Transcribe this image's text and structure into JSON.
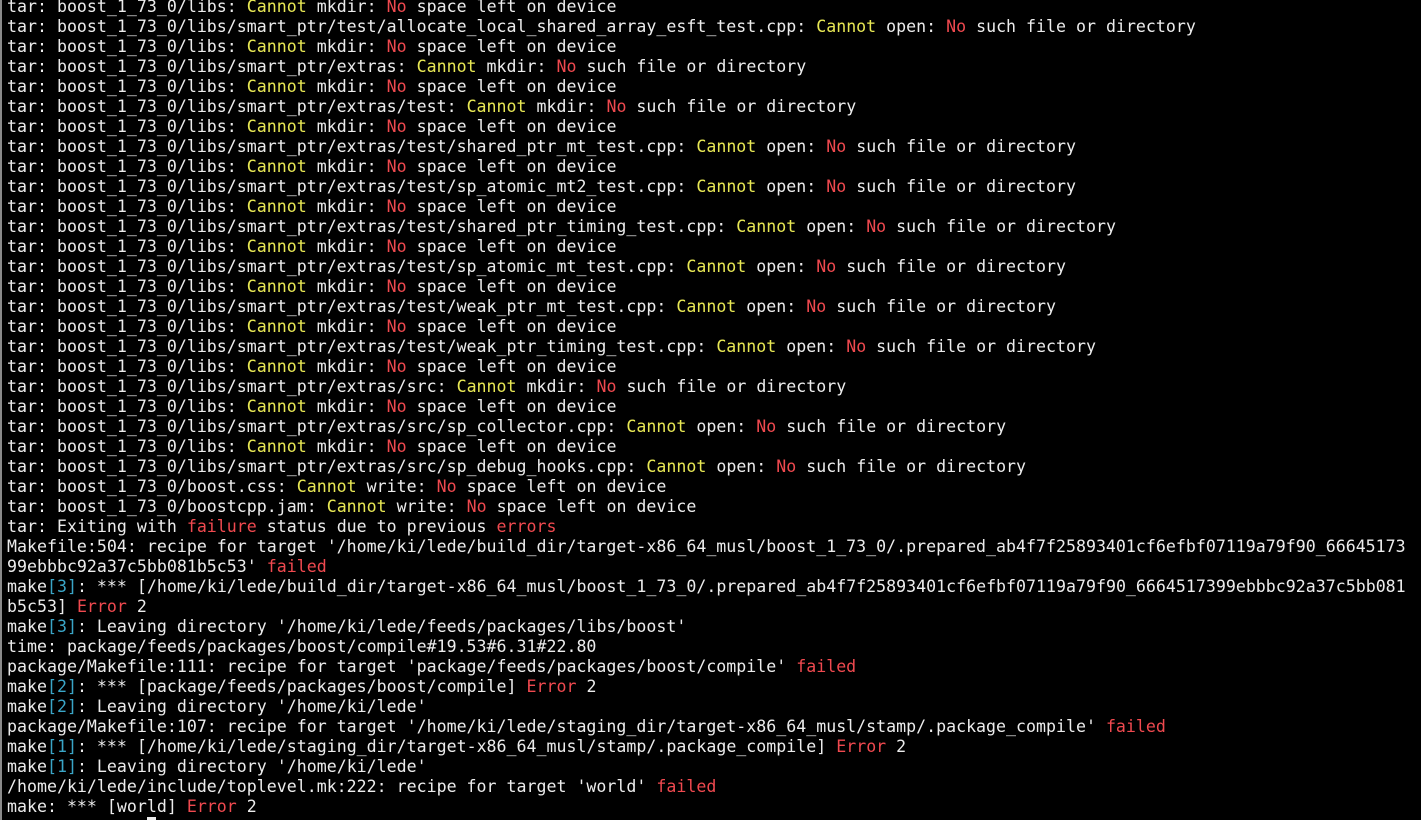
{
  "terminal": {
    "lines": [
      [
        [
          "d",
          "tar: boost_1_73_0/libs: "
        ],
        [
          "y",
          "Cannot"
        ],
        [
          "d",
          " mkdir: "
        ],
        [
          "r",
          "No"
        ],
        [
          "d",
          " space left on device"
        ]
      ],
      [
        [
          "d",
          "tar: boost_1_73_0/libs/smart_ptr/test/allocate_local_shared_array_esft_test.cpp: "
        ],
        [
          "y",
          "Cannot"
        ],
        [
          "d",
          " open: "
        ],
        [
          "r",
          "No"
        ],
        [
          "d",
          " such file or directory"
        ]
      ],
      [
        [
          "d",
          "tar: boost_1_73_0/libs: "
        ],
        [
          "y",
          "Cannot"
        ],
        [
          "d",
          " mkdir: "
        ],
        [
          "r",
          "No"
        ],
        [
          "d",
          " space left on device"
        ]
      ],
      [
        [
          "d",
          "tar: boost_1_73_0/libs/smart_ptr/extras: "
        ],
        [
          "y",
          "Cannot"
        ],
        [
          "d",
          " mkdir: "
        ],
        [
          "r",
          "No"
        ],
        [
          "d",
          " such file or directory"
        ]
      ],
      [
        [
          "d",
          "tar: boost_1_73_0/libs: "
        ],
        [
          "y",
          "Cannot"
        ],
        [
          "d",
          " mkdir: "
        ],
        [
          "r",
          "No"
        ],
        [
          "d",
          " space left on device"
        ]
      ],
      [
        [
          "d",
          "tar: boost_1_73_0/libs/smart_ptr/extras/test: "
        ],
        [
          "y",
          "Cannot"
        ],
        [
          "d",
          " mkdir: "
        ],
        [
          "r",
          "No"
        ],
        [
          "d",
          " such file or directory"
        ]
      ],
      [
        [
          "d",
          "tar: boost_1_73_0/libs: "
        ],
        [
          "y",
          "Cannot"
        ],
        [
          "d",
          " mkdir: "
        ],
        [
          "r",
          "No"
        ],
        [
          "d",
          " space left on device"
        ]
      ],
      [
        [
          "d",
          "tar: boost_1_73_0/libs/smart_ptr/extras/test/shared_ptr_mt_test.cpp: "
        ],
        [
          "y",
          "Cannot"
        ],
        [
          "d",
          " open: "
        ],
        [
          "r",
          "No"
        ],
        [
          "d",
          " such file or directory"
        ]
      ],
      [
        [
          "d",
          "tar: boost_1_73_0/libs: "
        ],
        [
          "y",
          "Cannot"
        ],
        [
          "d",
          " mkdir: "
        ],
        [
          "r",
          "No"
        ],
        [
          "d",
          " space left on device"
        ]
      ],
      [
        [
          "d",
          "tar: boost_1_73_0/libs/smart_ptr/extras/test/sp_atomic_mt2_test.cpp: "
        ],
        [
          "y",
          "Cannot"
        ],
        [
          "d",
          " open: "
        ],
        [
          "r",
          "No"
        ],
        [
          "d",
          " such file or directory"
        ]
      ],
      [
        [
          "d",
          "tar: boost_1_73_0/libs: "
        ],
        [
          "y",
          "Cannot"
        ],
        [
          "d",
          " mkdir: "
        ],
        [
          "r",
          "No"
        ],
        [
          "d",
          " space left on device"
        ]
      ],
      [
        [
          "d",
          "tar: boost_1_73_0/libs/smart_ptr/extras/test/shared_ptr_timing_test.cpp: "
        ],
        [
          "y",
          "Cannot"
        ],
        [
          "d",
          " open: "
        ],
        [
          "r",
          "No"
        ],
        [
          "d",
          " such file or directory"
        ]
      ],
      [
        [
          "d",
          "tar: boost_1_73_0/libs: "
        ],
        [
          "y",
          "Cannot"
        ],
        [
          "d",
          " mkdir: "
        ],
        [
          "r",
          "No"
        ],
        [
          "d",
          " space left on device"
        ]
      ],
      [
        [
          "d",
          "tar: boost_1_73_0/libs/smart_ptr/extras/test/sp_atomic_mt_test.cpp: "
        ],
        [
          "y",
          "Cannot"
        ],
        [
          "d",
          " open: "
        ],
        [
          "r",
          "No"
        ],
        [
          "d",
          " such file or directory"
        ]
      ],
      [
        [
          "d",
          "tar: boost_1_73_0/libs: "
        ],
        [
          "y",
          "Cannot"
        ],
        [
          "d",
          " mkdir: "
        ],
        [
          "r",
          "No"
        ],
        [
          "d",
          " space left on device"
        ]
      ],
      [
        [
          "d",
          "tar: boost_1_73_0/libs/smart_ptr/extras/test/weak_ptr_mt_test.cpp: "
        ],
        [
          "y",
          "Cannot"
        ],
        [
          "d",
          " open: "
        ],
        [
          "r",
          "No"
        ],
        [
          "d",
          " such file or directory"
        ]
      ],
      [
        [
          "d",
          "tar: boost_1_73_0/libs: "
        ],
        [
          "y",
          "Cannot"
        ],
        [
          "d",
          " mkdir: "
        ],
        [
          "r",
          "No"
        ],
        [
          "d",
          " space left on device"
        ]
      ],
      [
        [
          "d",
          "tar: boost_1_73_0/libs/smart_ptr/extras/test/weak_ptr_timing_test.cpp: "
        ],
        [
          "y",
          "Cannot"
        ],
        [
          "d",
          " open: "
        ],
        [
          "r",
          "No"
        ],
        [
          "d",
          " such file or directory"
        ]
      ],
      [
        [
          "d",
          "tar: boost_1_73_0/libs: "
        ],
        [
          "y",
          "Cannot"
        ],
        [
          "d",
          " mkdir: "
        ],
        [
          "r",
          "No"
        ],
        [
          "d",
          " space left on device"
        ]
      ],
      [
        [
          "d",
          "tar: boost_1_73_0/libs/smart_ptr/extras/src: "
        ],
        [
          "y",
          "Cannot"
        ],
        [
          "d",
          " mkdir: "
        ],
        [
          "r",
          "No"
        ],
        [
          "d",
          " such file or directory"
        ]
      ],
      [
        [
          "d",
          "tar: boost_1_73_0/libs: "
        ],
        [
          "y",
          "Cannot"
        ],
        [
          "d",
          " mkdir: "
        ],
        [
          "r",
          "No"
        ],
        [
          "d",
          " space left on device"
        ]
      ],
      [
        [
          "d",
          "tar: boost_1_73_0/libs/smart_ptr/extras/src/sp_collector.cpp: "
        ],
        [
          "y",
          "Cannot"
        ],
        [
          "d",
          " open: "
        ],
        [
          "r",
          "No"
        ],
        [
          "d",
          " such file or directory"
        ]
      ],
      [
        [
          "d",
          "tar: boost_1_73_0/libs: "
        ],
        [
          "y",
          "Cannot"
        ],
        [
          "d",
          " mkdir: "
        ],
        [
          "r",
          "No"
        ],
        [
          "d",
          " space left on device"
        ]
      ],
      [
        [
          "d",
          "tar: boost_1_73_0/libs/smart_ptr/extras/src/sp_debug_hooks.cpp: "
        ],
        [
          "y",
          "Cannot"
        ],
        [
          "d",
          " open: "
        ],
        [
          "r",
          "No"
        ],
        [
          "d",
          " such file or directory"
        ]
      ],
      [
        [
          "d",
          "tar: boost_1_73_0/boost.css: "
        ],
        [
          "y",
          "Cannot"
        ],
        [
          "d",
          " write: "
        ],
        [
          "r",
          "No"
        ],
        [
          "d",
          " space left on device"
        ]
      ],
      [
        [
          "d",
          "tar: boost_1_73_0/boostcpp.jam: "
        ],
        [
          "y",
          "Cannot"
        ],
        [
          "d",
          " write: "
        ],
        [
          "r",
          "No"
        ],
        [
          "d",
          " space left on device"
        ]
      ],
      [
        [
          "d",
          "tar: Exiting with "
        ],
        [
          "r",
          "failure"
        ],
        [
          "d",
          " status due to previous "
        ],
        [
          "r",
          "errors"
        ]
      ],
      [
        [
          "d",
          "Makefile:504: recipe for target '/home/ki/lede/build_dir/target-x86_64_musl/boost_1_73_0/.prepared_ab4f7f25893401cf6efbf07119a79f90_66645173"
        ]
      ],
      [
        [
          "d",
          "99ebbbc92a37c5bb081b5c53' "
        ],
        [
          "r",
          "failed"
        ]
      ],
      [
        [
          "d",
          "make"
        ],
        [
          "c",
          "[3]"
        ],
        [
          "d",
          ": *** [/home/ki/lede/build_dir/target-x86_64_musl/boost_1_73_0/.prepared_ab4f7f25893401cf6efbf07119a79f90_6664517399ebbbc92a37c5bb081"
        ]
      ],
      [
        [
          "d",
          "b5c53] "
        ],
        [
          "r",
          "Error"
        ],
        [
          "d",
          " 2"
        ]
      ],
      [
        [
          "d",
          "make"
        ],
        [
          "c",
          "[3]"
        ],
        [
          "d",
          ": Leaving directory '/home/ki/lede/feeds/packages/libs/boost'"
        ]
      ],
      [
        [
          "d",
          "time: package/feeds/packages/boost/compile#19.53#6.31#22.80"
        ]
      ],
      [
        [
          "d",
          "package/Makefile:111: recipe for target 'package/feeds/packages/boost/compile' "
        ],
        [
          "r",
          "failed"
        ]
      ],
      [
        [
          "d",
          "make"
        ],
        [
          "c",
          "[2]"
        ],
        [
          "d",
          ": *** [package/feeds/packages/boost/compile] "
        ],
        [
          "r",
          "Error"
        ],
        [
          "d",
          " 2"
        ]
      ],
      [
        [
          "d",
          "make"
        ],
        [
          "c",
          "[2]"
        ],
        [
          "d",
          ": Leaving directory '/home/ki/lede'"
        ]
      ],
      [
        [
          "d",
          "package/Makefile:107: recipe for target '/home/ki/lede/staging_dir/target-x86_64_musl/stamp/.package_compile' "
        ],
        [
          "r",
          "failed"
        ]
      ],
      [
        [
          "d",
          "make"
        ],
        [
          "c",
          "[1]"
        ],
        [
          "d",
          ": *** [/home/ki/lede/staging_dir/target-x86_64_musl/stamp/.package_compile] "
        ],
        [
          "r",
          "Error"
        ],
        [
          "d",
          " 2"
        ]
      ],
      [
        [
          "d",
          "make"
        ],
        [
          "c",
          "[1]"
        ],
        [
          "d",
          ": Leaving directory '/home/ki/lede'"
        ]
      ],
      [
        [
          "d",
          "/home/ki/lede/include/toplevel.mk:222: recipe for target 'world' "
        ],
        [
          "r",
          "failed"
        ]
      ],
      [
        [
          "d",
          "make: *** [world] "
        ],
        [
          "r",
          "Error"
        ],
        [
          "d",
          " 2"
        ]
      ]
    ],
    "colors": {
      "background": "#000000",
      "default_text": "#ececec",
      "warning_yellow": "#e8e854",
      "error_red": "#f0494f",
      "make_level_cyan": "#3aa5c7"
    }
  }
}
